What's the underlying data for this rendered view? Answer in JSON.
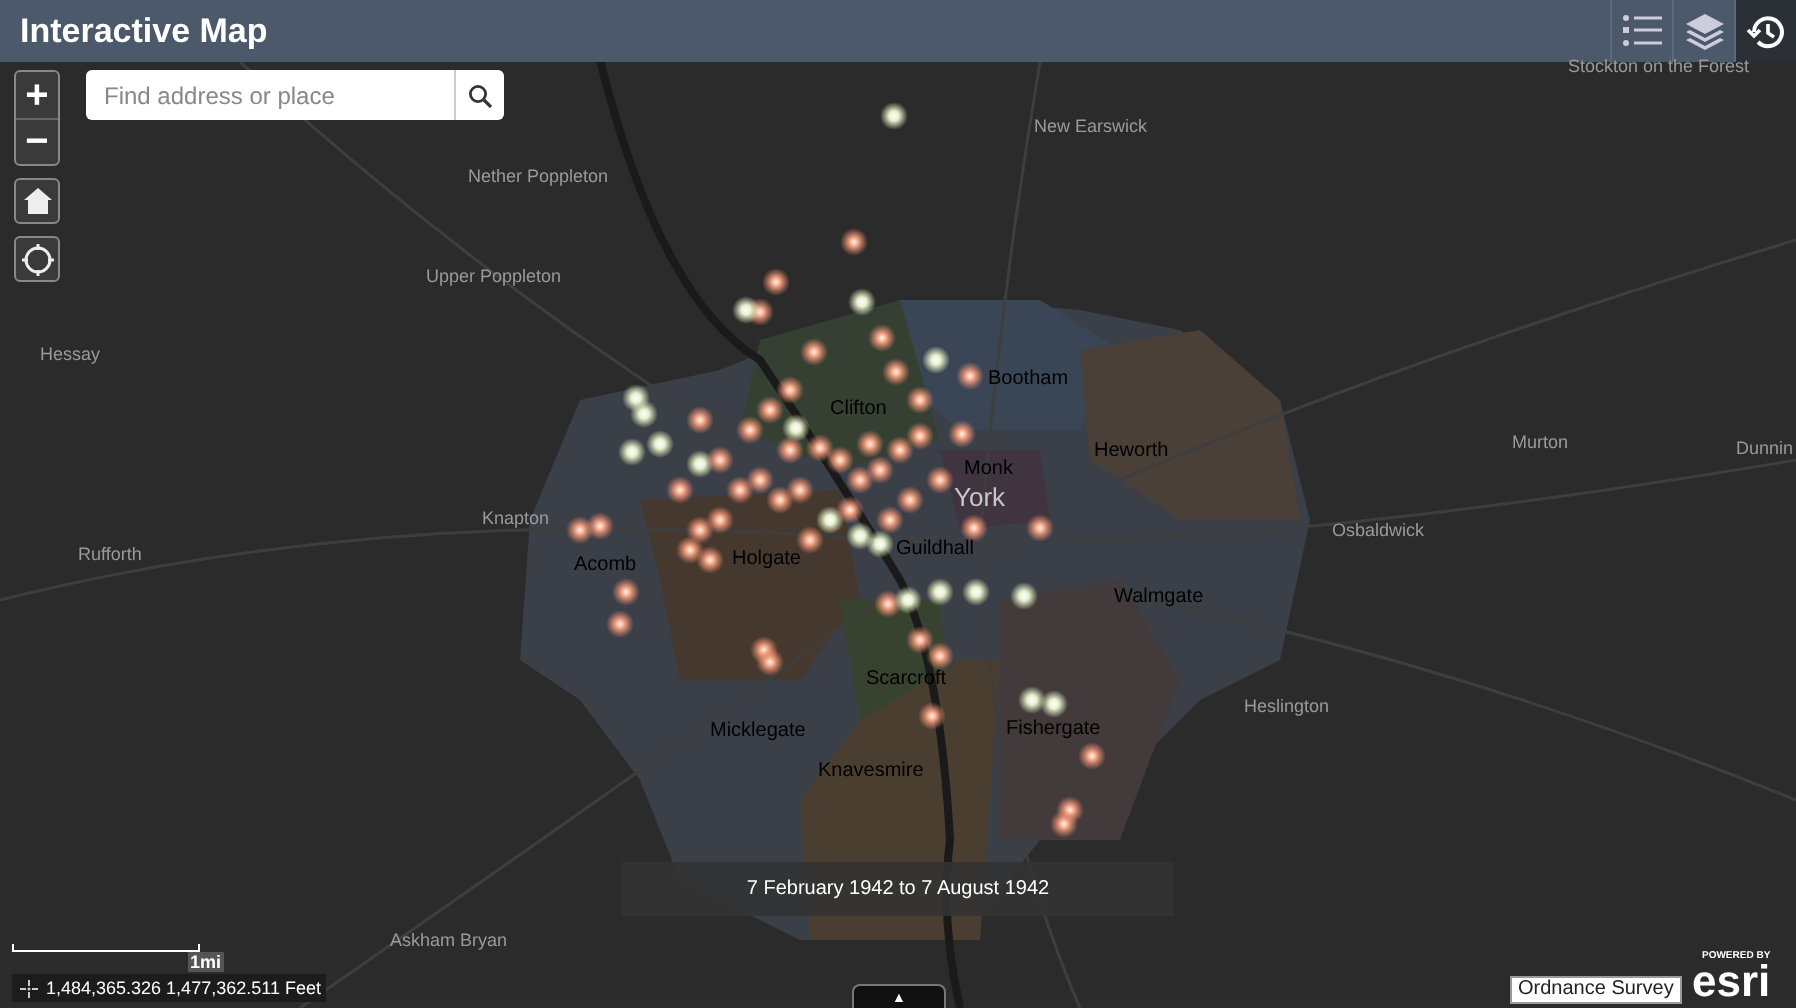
{
  "header": {
    "title": "Interactive Map",
    "tools": [
      {
        "kind": "legend",
        "selected": false
      },
      {
        "kind": "layers",
        "selected": false
      },
      {
        "kind": "time",
        "selected": true
      }
    ]
  },
  "zoom": {
    "in": "+",
    "out": "−"
  },
  "search": {
    "placeholder": "Find address or place"
  },
  "place_labels": [
    {
      "text": "Stockton on the Forest",
      "kind": "outer"
    },
    {
      "text": "New Earswick",
      "kind": "outer"
    },
    {
      "text": "Nether Poppleton",
      "kind": "outer"
    },
    {
      "text": "Upper Poppleton",
      "kind": "outer"
    },
    {
      "text": "Hessay",
      "kind": "outer"
    },
    {
      "text": "Bootham",
      "kind": "district"
    },
    {
      "text": "Clifton",
      "kind": "district"
    },
    {
      "text": "Monk",
      "kind": "district"
    },
    {
      "text": "York",
      "kind": "city"
    },
    {
      "text": "Heworth",
      "kind": "district"
    },
    {
      "text": "Murton",
      "kind": "outer"
    },
    {
      "text": "Dunnin",
      "kind": "outer"
    },
    {
      "text": "Knapton",
      "kind": "outer"
    },
    {
      "text": "Rufforth",
      "kind": "outer"
    },
    {
      "text": "Osbaldwick",
      "kind": "outer"
    },
    {
      "text": "Acomb",
      "kind": "district"
    },
    {
      "text": "Holgate",
      "kind": "district"
    },
    {
      "text": "Guildhall",
      "kind": "district"
    },
    {
      "text": "Walmgate",
      "kind": "district"
    },
    {
      "text": "Scarcroft",
      "kind": "district"
    },
    {
      "text": "Heslington",
      "kind": "outer"
    },
    {
      "text": "Micklegate",
      "kind": "district"
    },
    {
      "text": "Fishergate",
      "kind": "district"
    },
    {
      "text": "Knavesmire",
      "kind": "district"
    },
    {
      "text": "Askham Bryan",
      "kind": "outer"
    }
  ],
  "time_extent": "7 February 1942 to 7 August 1942",
  "scale": "1mi",
  "coordinates": "1,484,365.326 1,477,362.511 Feet",
  "attribution": "Ordnance Survey",
  "logo": {
    "tagline": "POWERED BY",
    "name": "esri"
  },
  "toggle": "▲"
}
